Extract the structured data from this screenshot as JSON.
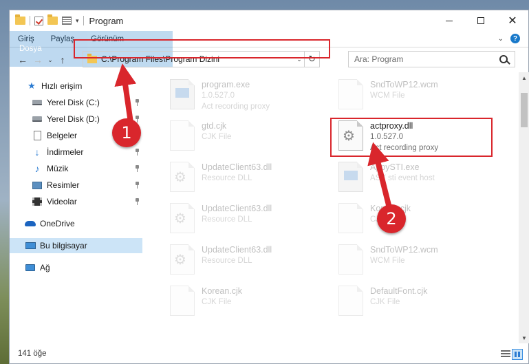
{
  "window": {
    "title": "Program"
  },
  "ribbon": {
    "tabs": [
      "Dosya",
      "Giriş",
      "Paylaş",
      "Görünüm"
    ]
  },
  "nav": {
    "back": "←",
    "forward": "→",
    "recent": "⌄",
    "up": "↑",
    "address": "C:\\Program Files\\Program Dizini",
    "refresh": "↻",
    "search_placeholder": "Ara: Program"
  },
  "sidebar": {
    "items": [
      {
        "label": "Hızlı erişim",
        "icon": "star-icon"
      },
      {
        "label": "Yerel Disk (C:)",
        "icon": "drive-icon",
        "pinned": true
      },
      {
        "label": "Yerel Disk (D:)",
        "icon": "drive-icon",
        "pinned": true
      },
      {
        "label": "Belgeler",
        "icon": "documents-icon",
        "pinned": true
      },
      {
        "label": "İndirmeler",
        "icon": "downloads-icon",
        "pinned": true
      },
      {
        "label": "Müzik",
        "icon": "music-icon",
        "pinned": true
      },
      {
        "label": "Resimler",
        "icon": "pictures-icon",
        "pinned": true
      },
      {
        "label": "Videolar",
        "icon": "videos-icon",
        "pinned": true
      },
      {
        "label": "OneDrive",
        "icon": "onedrive-icon"
      },
      {
        "label": "Bu bilgisayar",
        "icon": "computer-icon",
        "selected": true
      },
      {
        "label": "Ağ",
        "icon": "network-icon"
      }
    ]
  },
  "files": [
    {
      "name": "program.exe",
      "line2": "1.0.527.0",
      "line3": "Act recording proxy",
      "icon": "exe-icon"
    },
    {
      "name": "SndToWP12.wcm",
      "line2": "WCM File",
      "line3": "",
      "icon": "file-icon"
    },
    {
      "name": "gtd.cjk",
      "line2": "CJK File",
      "line3": "",
      "icon": "file-icon"
    },
    {
      "name": "actproxy.dll",
      "line2": "1.0.527.0",
      "line3": "Act recording proxy",
      "icon": "gears-icon",
      "focus": true
    },
    {
      "name": "UpdateClient63.dll",
      "line2": "Resource DLL",
      "line3": "",
      "icon": "gears-icon"
    },
    {
      "name": "AppySTI.exe",
      "line2": "ASY sti event host",
      "line3": "",
      "icon": "exe-icon"
    },
    {
      "name": "UpdateClient63.dll",
      "line2": "Resource DLL",
      "line3": "",
      "icon": "gears-icon"
    },
    {
      "name": "Korean.cjk",
      "line2": "CJK File",
      "line3": "",
      "icon": "file-icon"
    },
    {
      "name": "UpdateClient63.dll",
      "line2": "Resource DLL",
      "line3": "",
      "icon": "gears-icon"
    },
    {
      "name": "SndToWP12.wcm",
      "line2": "WCM File",
      "line3": "",
      "icon": "file-icon"
    },
    {
      "name": "Korean.cjk",
      "line2": "CJK File",
      "line3": "",
      "icon": "file-icon"
    },
    {
      "name": "DefaultFont.cjk",
      "line2": "CJK File",
      "line3": "",
      "icon": "file-icon"
    }
  ],
  "status": {
    "count": "141 öğe"
  },
  "callouts": {
    "step1": "1",
    "step2": "2",
    "color": "#d9262c"
  }
}
